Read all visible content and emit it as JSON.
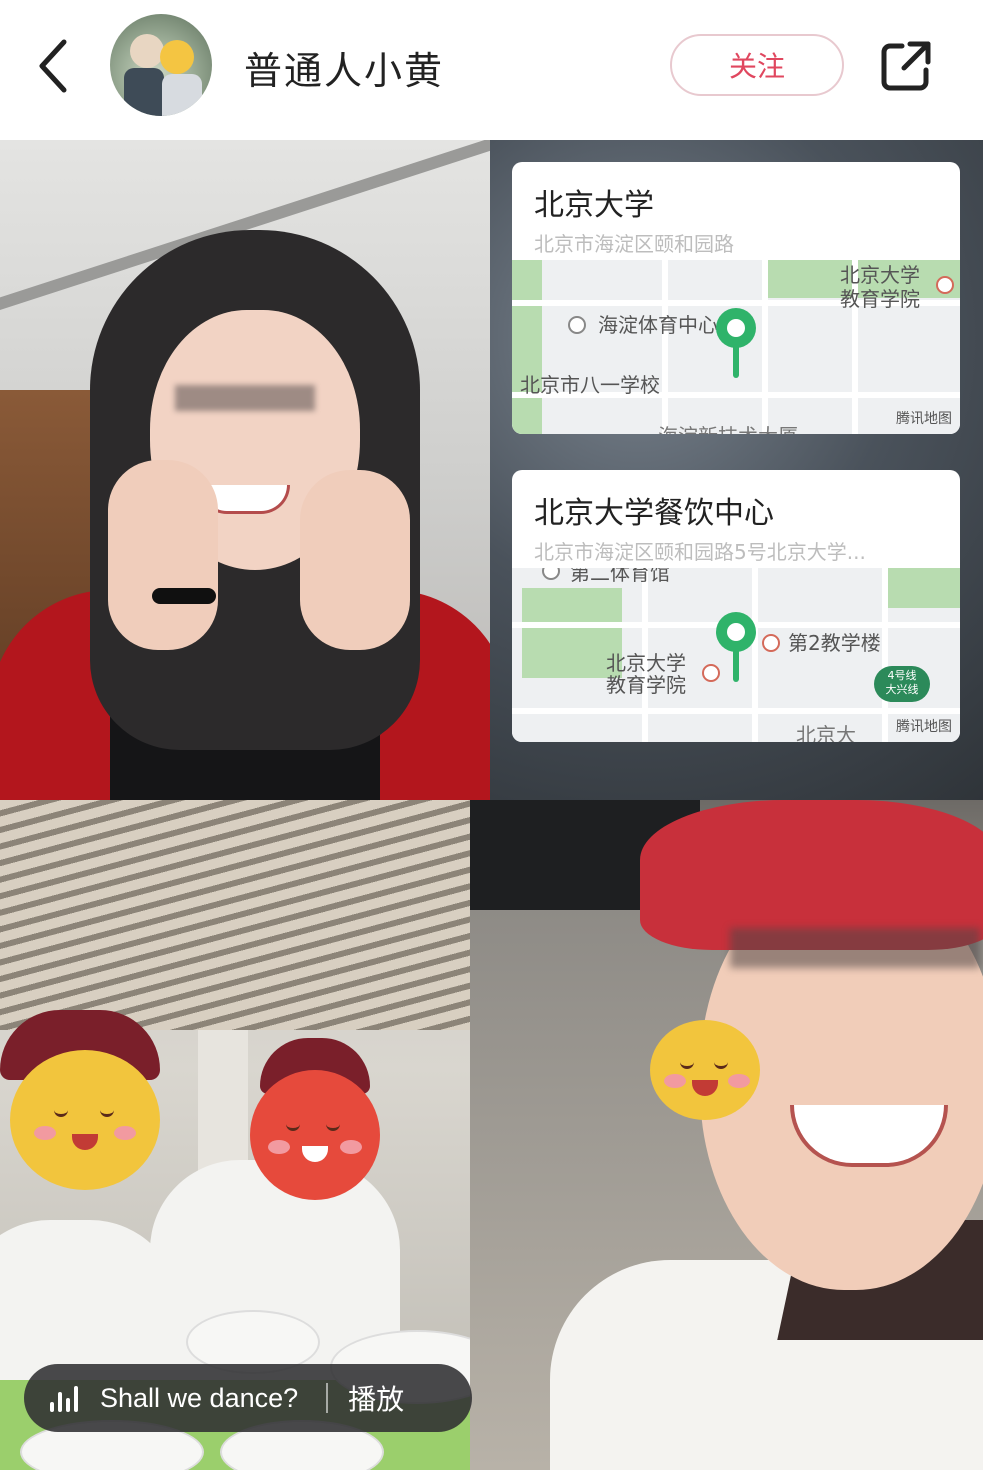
{
  "header": {
    "back_icon": "chevron-left-icon",
    "username": "普通人小黄",
    "follow_label": "关注",
    "share_icon": "share-external-icon",
    "accent_color": "#e0475f"
  },
  "map_cards": [
    {
      "title": "北京大学",
      "address": "北京市海淀区颐和园路",
      "labels": [
        "海淀体育中心",
        "北京大学",
        "教育学院",
        "北京市八一学校",
        "海淀新技术大厦"
      ],
      "provider": "腾讯地图"
    },
    {
      "title": "北京大学餐饮中心",
      "address": "北京市海淀区颐和园路5号北京大学...",
      "labels": [
        "第二体育馆",
        "第2教学楼",
        "北京大学",
        "教育学院",
        "北京大"
      ],
      "metro": [
        "4号线",
        "大兴线"
      ],
      "provider": "腾讯地图"
    }
  ],
  "audio": {
    "icon": "audio-bars-icon",
    "title": "Shall we dance?",
    "play_label": "播放"
  }
}
